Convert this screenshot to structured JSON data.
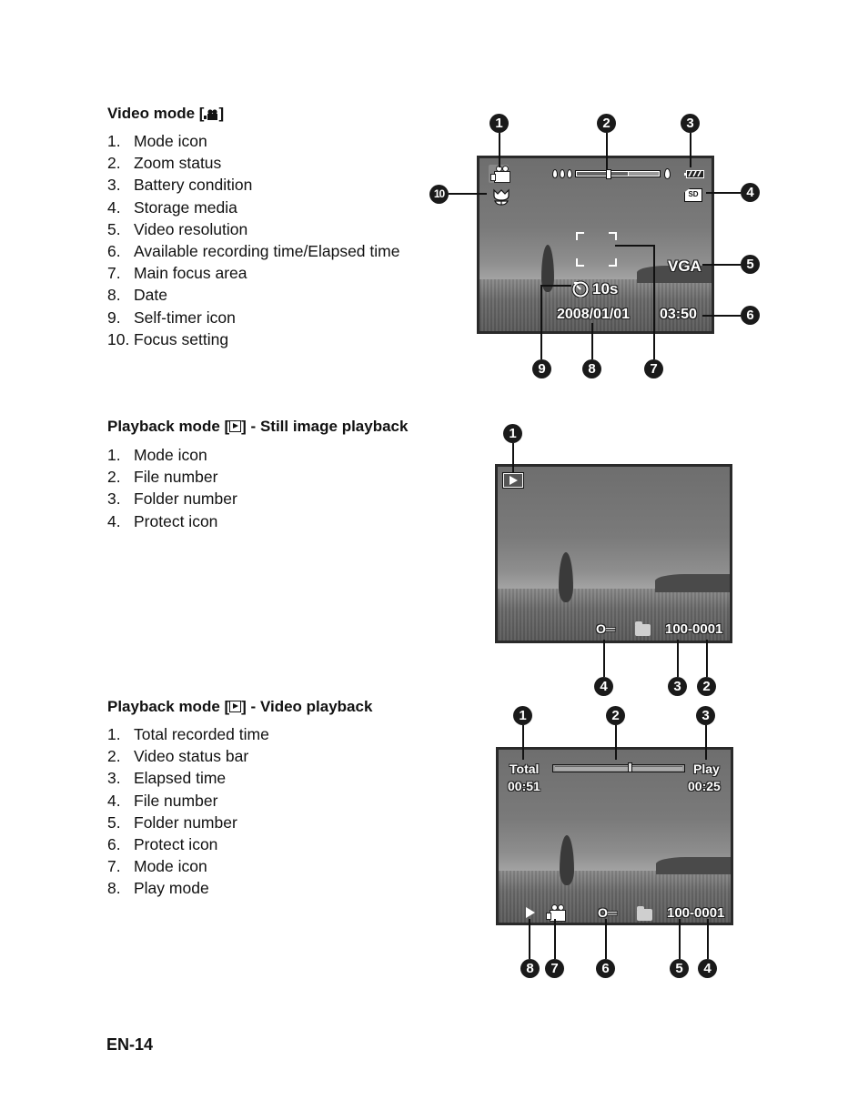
{
  "page_number": "EN-14",
  "sections": {
    "video_mode": {
      "title_prefix": "Video mode [",
      "title_icon": "video-camera-icon",
      "title_suffix": "]",
      "items": [
        {
          "num": "1.",
          "label": "Mode icon"
        },
        {
          "num": "2.",
          "label": "Zoom status"
        },
        {
          "num": "3.",
          "label": "Battery condition"
        },
        {
          "num": "4.",
          "label": "Storage media"
        },
        {
          "num": "5.",
          "label": "Video resolution"
        },
        {
          "num": "6.",
          "label": "Available recording time/Elapsed time"
        },
        {
          "num": "7.",
          "label": "Main focus area"
        },
        {
          "num": "8.",
          "label": "Date"
        },
        {
          "num": "9.",
          "label": "Self-timer icon"
        },
        {
          "num": "10.",
          "label": "Focus setting"
        }
      ],
      "screen": {
        "storage_label": "SD",
        "resolution": "VGA",
        "self_timer": "10s",
        "date": "2008/01/01",
        "time_remaining": "03:50",
        "zoom_optical_fraction": 0.38,
        "zoom_digital_start_fraction": 0.63
      },
      "callouts": [
        "1",
        "2",
        "3",
        "4",
        "5",
        "6",
        "7",
        "8",
        "9",
        "10"
      ]
    },
    "still_playback": {
      "title_prefix": "Playback mode  [",
      "title_icon": "play-icon",
      "title_suffix": "]  -  Still image playback",
      "items": [
        {
          "num": "1.",
          "label": "Mode icon"
        },
        {
          "num": "2.",
          "label": "File number"
        },
        {
          "num": "3.",
          "label": "Folder number"
        },
        {
          "num": "4.",
          "label": "Protect icon"
        }
      ],
      "screen": {
        "file_id": "100-0001",
        "protect_glyph": "O═"
      },
      "callouts": [
        "1",
        "2",
        "3",
        "4"
      ]
    },
    "video_playback": {
      "title_prefix": "Playback mode  [",
      "title_icon": "play-icon",
      "title_suffix": "]  -  Video playback",
      "items": [
        {
          "num": "1.",
          "label": "Total recorded time"
        },
        {
          "num": "2.",
          "label": "Video status bar"
        },
        {
          "num": "3.",
          "label": "Elapsed time"
        },
        {
          "num": "4.",
          "label": "File number"
        },
        {
          "num": "5.",
          "label": "Folder number"
        },
        {
          "num": "6.",
          "label": "Protect icon"
        },
        {
          "num": "7.",
          "label": "Mode icon"
        },
        {
          "num": "8.",
          "label": "Play mode"
        }
      ],
      "screen": {
        "total_label": "Total",
        "total_time": "00:51",
        "play_label": "Play",
        "play_time": "00:25",
        "progress_fraction": 0.58,
        "file_id": "100-0001",
        "protect_glyph": "O═"
      },
      "callouts": [
        "1",
        "2",
        "3",
        "4",
        "5",
        "6",
        "7",
        "8"
      ]
    }
  }
}
